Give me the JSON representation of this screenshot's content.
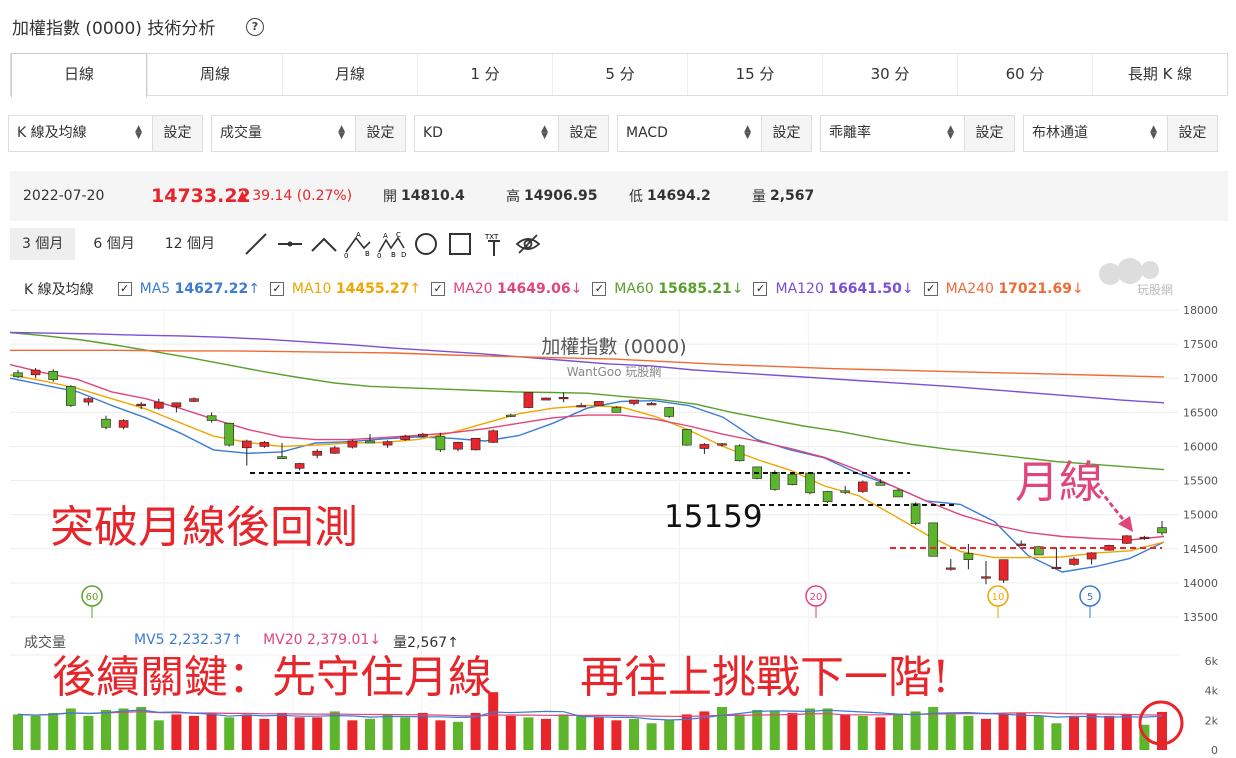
{
  "header": {
    "title": "加權指數 (0000) 技術分析",
    "help_icon": "question-circle-icon"
  },
  "tabs": [
    "日線",
    "周線",
    "月線",
    "1 分",
    "5 分",
    "15 分",
    "30 分",
    "60 分",
    "長期 K 線"
  ],
  "selectors": [
    {
      "value": "K 線及均線",
      "button": "設定"
    },
    {
      "value": "成交量",
      "button": "設定"
    },
    {
      "value": "KD",
      "button": "設定"
    },
    {
      "value": "MACD",
      "button": "設定"
    },
    {
      "value": "乖離率",
      "button": "設定"
    },
    {
      "value": "布林通道",
      "button": "設定"
    }
  ],
  "quote": {
    "date": "2022-07-20",
    "price": "14733.22",
    "change": "▲ 39.14 (0.27%)",
    "open_label": "開",
    "open": "14810.4",
    "high_label": "高",
    "high": "14906.95",
    "low_label": "低",
    "low": "14694.2",
    "vol_label": "量",
    "vol": "2,567"
  },
  "ranges": [
    "3 個月",
    "6 個月",
    "12 個月"
  ],
  "tools": [
    "line-tool-icon",
    "horizontal-line-icon",
    "angle-line-icon",
    "abc-pattern-icon",
    "abcd-pattern-icon",
    "circle-tool-icon",
    "rectangle-tool-icon",
    "text-tool-icon",
    "hide-eye-icon"
  ],
  "ma_legend": {
    "label": "K 線及均線",
    "items": [
      {
        "name": "MA5",
        "value": "14627.22",
        "arrow": "↑",
        "color": "#3a7bd5"
      },
      {
        "name": "MA10",
        "value": "14455.27",
        "arrow": "↑",
        "color": "#f0a500"
      },
      {
        "name": "MA20",
        "value": "14649.06",
        "arrow": "↓",
        "color": "#e0457b"
      },
      {
        "name": "MA60",
        "value": "15685.21",
        "arrow": "↓",
        "color": "#5aa02c"
      },
      {
        "name": "MA120",
        "value": "16641.50",
        "arrow": "↓",
        "color": "#7b4fd6"
      },
      {
        "name": "MA240",
        "value": "17021.69",
        "arrow": "↓",
        "color": "#f06a35"
      }
    ]
  },
  "watermark": {
    "title": "加權指數 (0000)",
    "sub": "WantGoo 玩股網",
    "logo_text": "玩股網"
  },
  "annotations": {
    "breakout": "突破月線後回測",
    "level": "15159",
    "month_line": "月線",
    "bottom": "後續關鍵：先守住月線　　再往上挑戰下一階!"
  },
  "ma_badges": [
    "60",
    "20",
    "10",
    "5"
  ],
  "vol_legend": {
    "label": "成交量",
    "mv5": "MV5 2,232.37↑",
    "mv20": "MV20 2,379.01↓",
    "vol": "量2,567↑"
  },
  "colors": {
    "up": "#e8252a",
    "down": "#5cb52b",
    "accent": "#e8252a"
  },
  "chart_data": {
    "type": "candlestick",
    "title": "加權指數 (0000)",
    "y_ticks": [
      18000,
      17500,
      17000,
      16500,
      16000,
      15500,
      15000,
      14500,
      14000,
      13500
    ],
    "ylim": [
      13500,
      18000
    ],
    "volume_ticks": [
      "6k",
      "4k",
      "2k",
      "0"
    ],
    "volume_ylim": [
      0,
      6000
    ],
    "candles": [
      [
        17080,
        17120,
        17000,
        17020
      ],
      [
        17050,
        17150,
        17000,
        17120
      ],
      [
        17100,
        17130,
        16950,
        16980
      ],
      [
        16880,
        16900,
        16580,
        16600
      ],
      [
        16650,
        16720,
        16600,
        16700
      ],
      [
        16400,
        16450,
        16250,
        16280
      ],
      [
        16280,
        16400,
        16250,
        16380
      ],
      [
        16600,
        16650,
        16550,
        16620
      ],
      [
        16560,
        16700,
        16540,
        16650
      ],
      [
        16580,
        16640,
        16500,
        16640
      ],
      [
        16660,
        16720,
        16650,
        16700
      ],
      [
        16450,
        16500,
        16350,
        16380
      ],
      [
        16340,
        16350,
        16000,
        16020
      ],
      [
        15980,
        16100,
        15720,
        16080
      ],
      [
        16000,
        16080,
        15980,
        16060
      ],
      [
        15850,
        16050,
        15820,
        15820
      ],
      [
        15680,
        15760,
        15650,
        15750
      ],
      [
        15870,
        15960,
        15830,
        15930
      ],
      [
        15900,
        16010,
        15890,
        15980
      ],
      [
        15990,
        16100,
        15970,
        16080
      ],
      [
        16080,
        16180,
        16050,
        16050
      ],
      [
        16020,
        16090,
        15980,
        16070
      ],
      [
        16100,
        16170,
        16080,
        16150
      ],
      [
        16150,
        16200,
        16140,
        16180
      ],
      [
        16150,
        16200,
        15920,
        15950
      ],
      [
        15960,
        16070,
        15930,
        16060
      ],
      [
        15950,
        16120,
        15940,
        16120
      ],
      [
        16060,
        16250,
        16050,
        16230
      ],
      [
        16460,
        16480,
        16430,
        16440
      ],
      [
        16570,
        16790,
        16560,
        16790
      ],
      [
        16680,
        16720,
        16680,
        16710
      ],
      [
        16720,
        16790,
        16650,
        16720
      ],
      [
        16590,
        16640,
        16580,
        16600
      ],
      [
        16600,
        16660,
        16590,
        16660
      ],
      [
        16570,
        16590,
        16500,
        16500
      ],
      [
        16630,
        16680,
        16600,
        16680
      ],
      [
        16630,
        16650,
        16610,
        16630
      ],
      [
        16570,
        16580,
        16420,
        16440
      ],
      [
        16250,
        16260,
        16010,
        16020
      ],
      [
        15970,
        16050,
        15890,
        16030
      ],
      [
        16030,
        16050,
        16000,
        16040
      ],
      [
        16010,
        16030,
        15780,
        15790
      ],
      [
        15700,
        15700,
        15520,
        15530
      ],
      [
        15620,
        15650,
        15350,
        15370
      ],
      [
        15590,
        15620,
        15430,
        15440
      ],
      [
        15610,
        15620,
        15300,
        15320
      ],
      [
        15340,
        15350,
        15170,
        15190
      ],
      [
        15350,
        15420,
        15300,
        15340
      ],
      [
        15340,
        15500,
        15320,
        15480
      ],
      [
        15470,
        15520,
        15440,
        15430
      ],
      [
        15360,
        15380,
        15260,
        15260
      ],
      [
        15160,
        15180,
        14850,
        14870
      ],
      [
        14880,
        14880,
        14390,
        14390
      ],
      [
        14220,
        14350,
        14180,
        14220
      ],
      [
        14430,
        14570,
        14200,
        14340
      ],
      [
        14090,
        14320,
        13980,
        14090
      ],
      [
        14040,
        14340,
        14000,
        14340
      ],
      [
        14570,
        14620,
        14540,
        14570
      ],
      [
        14530,
        14540,
        14410,
        14410
      ],
      [
        14230,
        14520,
        14210,
        14230
      ],
      [
        14270,
        14380,
        14250,
        14350
      ],
      [
        14350,
        14450,
        14270,
        14440
      ],
      [
        14480,
        14560,
        14470,
        14550
      ],
      [
        14580,
        14700,
        14570,
        14690
      ],
      [
        14650,
        14690,
        14630,
        14670
      ],
      [
        14810,
        14907,
        14694,
        14733
      ]
    ],
    "ma": {
      "MA5": [
        17000,
        16900,
        16800,
        16600,
        16420,
        16200,
        15950,
        15900,
        15920,
        16050,
        16070,
        16110,
        16140,
        16120,
        16080,
        16160,
        16340,
        16560,
        16660,
        16670,
        16600,
        16430,
        16100,
        15950,
        15830,
        15600,
        15420,
        15200,
        15150,
        14900,
        14400,
        14160,
        14240,
        14360,
        14600
      ],
      "MA10": [
        17050,
        16960,
        16850,
        16700,
        16550,
        16350,
        16150,
        16060,
        16000,
        16020,
        16050,
        16060,
        16100,
        16200,
        16340,
        16480,
        16560,
        16600,
        16580,
        16440,
        16240,
        16000,
        15810,
        15650,
        15420,
        15280,
        15000,
        14710,
        14460,
        14370,
        14370,
        14380,
        14440,
        14470,
        14600
      ],
      "MA20": [
        17200,
        17080,
        16980,
        16800,
        16700,
        16560,
        16400,
        16250,
        16140,
        16100,
        16100,
        16130,
        16160,
        16200,
        16260,
        16340,
        16420,
        16460,
        16460,
        16400,
        16300,
        16180,
        16080,
        15970,
        15840,
        15650,
        15420,
        15200,
        15000,
        14850,
        14740,
        14680,
        14650,
        14630,
        14680
      ],
      "MA60": [
        17670,
        17620,
        17560,
        17480,
        17390,
        17300,
        17200,
        17100,
        17010,
        16930,
        16880,
        16860,
        16840,
        16820,
        16800,
        16790,
        16780,
        16730,
        16690,
        16620,
        16500,
        16400,
        16300,
        16220,
        16120,
        16030,
        15960,
        15900,
        15840,
        15780,
        15740,
        15700,
        15660
      ],
      "MA120": [
        17670,
        17660,
        17650,
        17630,
        17620,
        17600,
        17570,
        17530,
        17490,
        17440,
        17400,
        17360,
        17310,
        17260,
        17210,
        17180,
        17120,
        17080,
        17040,
        17000,
        16960,
        16920,
        16880,
        16830,
        16780,
        16730,
        16680,
        16640
      ],
      "MA240": [
        17410,
        17410,
        17410,
        17400,
        17400,
        17390,
        17380,
        17370,
        17340,
        17320,
        17300,
        17280,
        17240,
        17200,
        17170,
        17140,
        17120,
        17100,
        17080,
        17060,
        17040,
        17020
      ]
    },
    "volume": [
      [
        2400,
        "down"
      ],
      [
        2300,
        "down"
      ],
      [
        2500,
        "down"
      ],
      [
        2800,
        "down"
      ],
      [
        2300,
        "down"
      ],
      [
        2700,
        "down"
      ],
      [
        2800,
        "down"
      ],
      [
        2900,
        "down"
      ],
      [
        2000,
        "down"
      ],
      [
        2400,
        "up"
      ],
      [
        2300,
        "up"
      ],
      [
        2500,
        "up"
      ],
      [
        2200,
        "down"
      ],
      [
        2400,
        "up"
      ],
      [
        2100,
        "up"
      ],
      [
        2500,
        "up"
      ],
      [
        2200,
        "up"
      ],
      [
        2200,
        "up"
      ],
      [
        2600,
        "down"
      ],
      [
        2000,
        "up"
      ],
      [
        2100,
        "down"
      ],
      [
        2400,
        "down"
      ],
      [
        2200,
        "down"
      ],
      [
        2500,
        "up"
      ],
      [
        2000,
        "up"
      ],
      [
        1900,
        "down"
      ],
      [
        2500,
        "up"
      ],
      [
        3900,
        "up"
      ],
      [
        2300,
        "up"
      ],
      [
        2200,
        "down"
      ],
      [
        2100,
        "up"
      ],
      [
        2400,
        "down"
      ],
      [
        2300,
        "down"
      ],
      [
        2200,
        "up"
      ],
      [
        2000,
        "up"
      ],
      [
        2100,
        "down"
      ],
      [
        1800,
        "down"
      ],
      [
        2000,
        "down"
      ],
      [
        2400,
        "up"
      ],
      [
        2600,
        "up"
      ],
      [
        2900,
        "down"
      ],
      [
        2400,
        "down"
      ],
      [
        2700,
        "down"
      ],
      [
        2600,
        "down"
      ],
      [
        2500,
        "up"
      ],
      [
        2800,
        "down"
      ],
      [
        2800,
        "down"
      ],
      [
        2400,
        "up"
      ],
      [
        2300,
        "down"
      ],
      [
        2200,
        "up"
      ],
      [
        2400,
        "down"
      ],
      [
        2600,
        "down"
      ],
      [
        2900,
        "down"
      ],
      [
        2400,
        "down"
      ],
      [
        2300,
        "down"
      ],
      [
        2100,
        "up"
      ],
      [
        2400,
        "up"
      ],
      [
        2500,
        "up"
      ],
      [
        2300,
        "down"
      ],
      [
        1800,
        "down"
      ],
      [
        2300,
        "up"
      ],
      [
        2400,
        "up"
      ],
      [
        2300,
        "up"
      ],
      [
        2400,
        "up"
      ],
      [
        1700,
        "down"
      ],
      [
        2567,
        "up"
      ]
    ]
  }
}
